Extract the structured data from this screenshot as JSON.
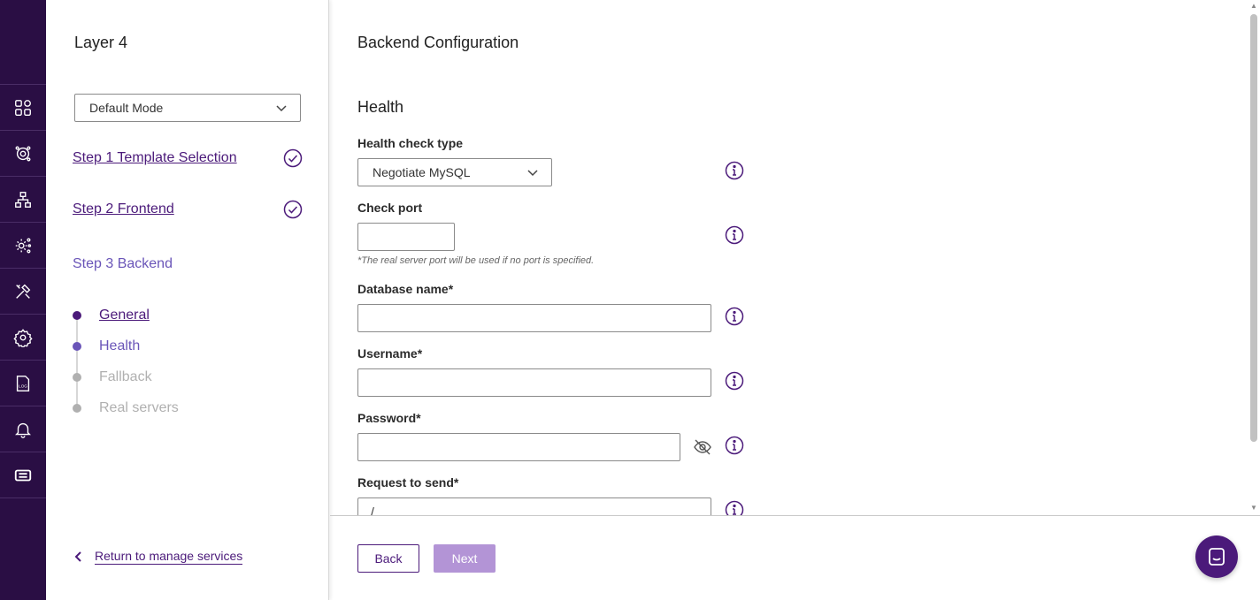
{
  "rail": {
    "items": [
      {
        "icon": "dashboard-icon"
      },
      {
        "icon": "services-icon"
      },
      {
        "icon": "network-icon"
      },
      {
        "icon": "advanced-settings-icon"
      },
      {
        "icon": "tools-icon"
      },
      {
        "icon": "settings-icon"
      },
      {
        "icon": "log-icon"
      },
      {
        "icon": "bell-icon"
      },
      {
        "icon": "ticket-icon"
      }
    ],
    "log_label": "LOG"
  },
  "wizard": {
    "title": "Layer 4",
    "mode": "Default Mode",
    "steps": [
      {
        "label": "Step 1 Template Selection",
        "done": true
      },
      {
        "label": "Step 2 Frontend",
        "done": true
      },
      {
        "label": "Step 3 Backend",
        "done": false
      }
    ],
    "substeps": [
      {
        "label": "General",
        "state": "visited"
      },
      {
        "label": "Health",
        "state": "current"
      },
      {
        "label": "Fallback",
        "state": "pending"
      },
      {
        "label": "Real servers",
        "state": "pending"
      }
    ],
    "return_label": "Return to manage services"
  },
  "main": {
    "title": "Backend Configuration",
    "section": "Health",
    "fields": {
      "health_check_type": {
        "label": "Health check type",
        "value": "Negotiate MySQL"
      },
      "check_port": {
        "label": "Check port",
        "value": "",
        "hint": "*The real server port will be used if no port is specified."
      },
      "database_name": {
        "label": "Database name*",
        "value": ""
      },
      "username": {
        "label": "Username*",
        "value": ""
      },
      "password": {
        "label": "Password*",
        "value": ""
      },
      "request": {
        "label": "Request to send*",
        "value": "/"
      }
    },
    "buttons": {
      "back": "Back",
      "next": "Next"
    }
  },
  "colors": {
    "rail_bg": "#2a0e44",
    "brand": "#4b1a7a",
    "current_step": "#6a55b8",
    "next_disabled": "#b394d6",
    "pending": "#b0b0b0"
  }
}
